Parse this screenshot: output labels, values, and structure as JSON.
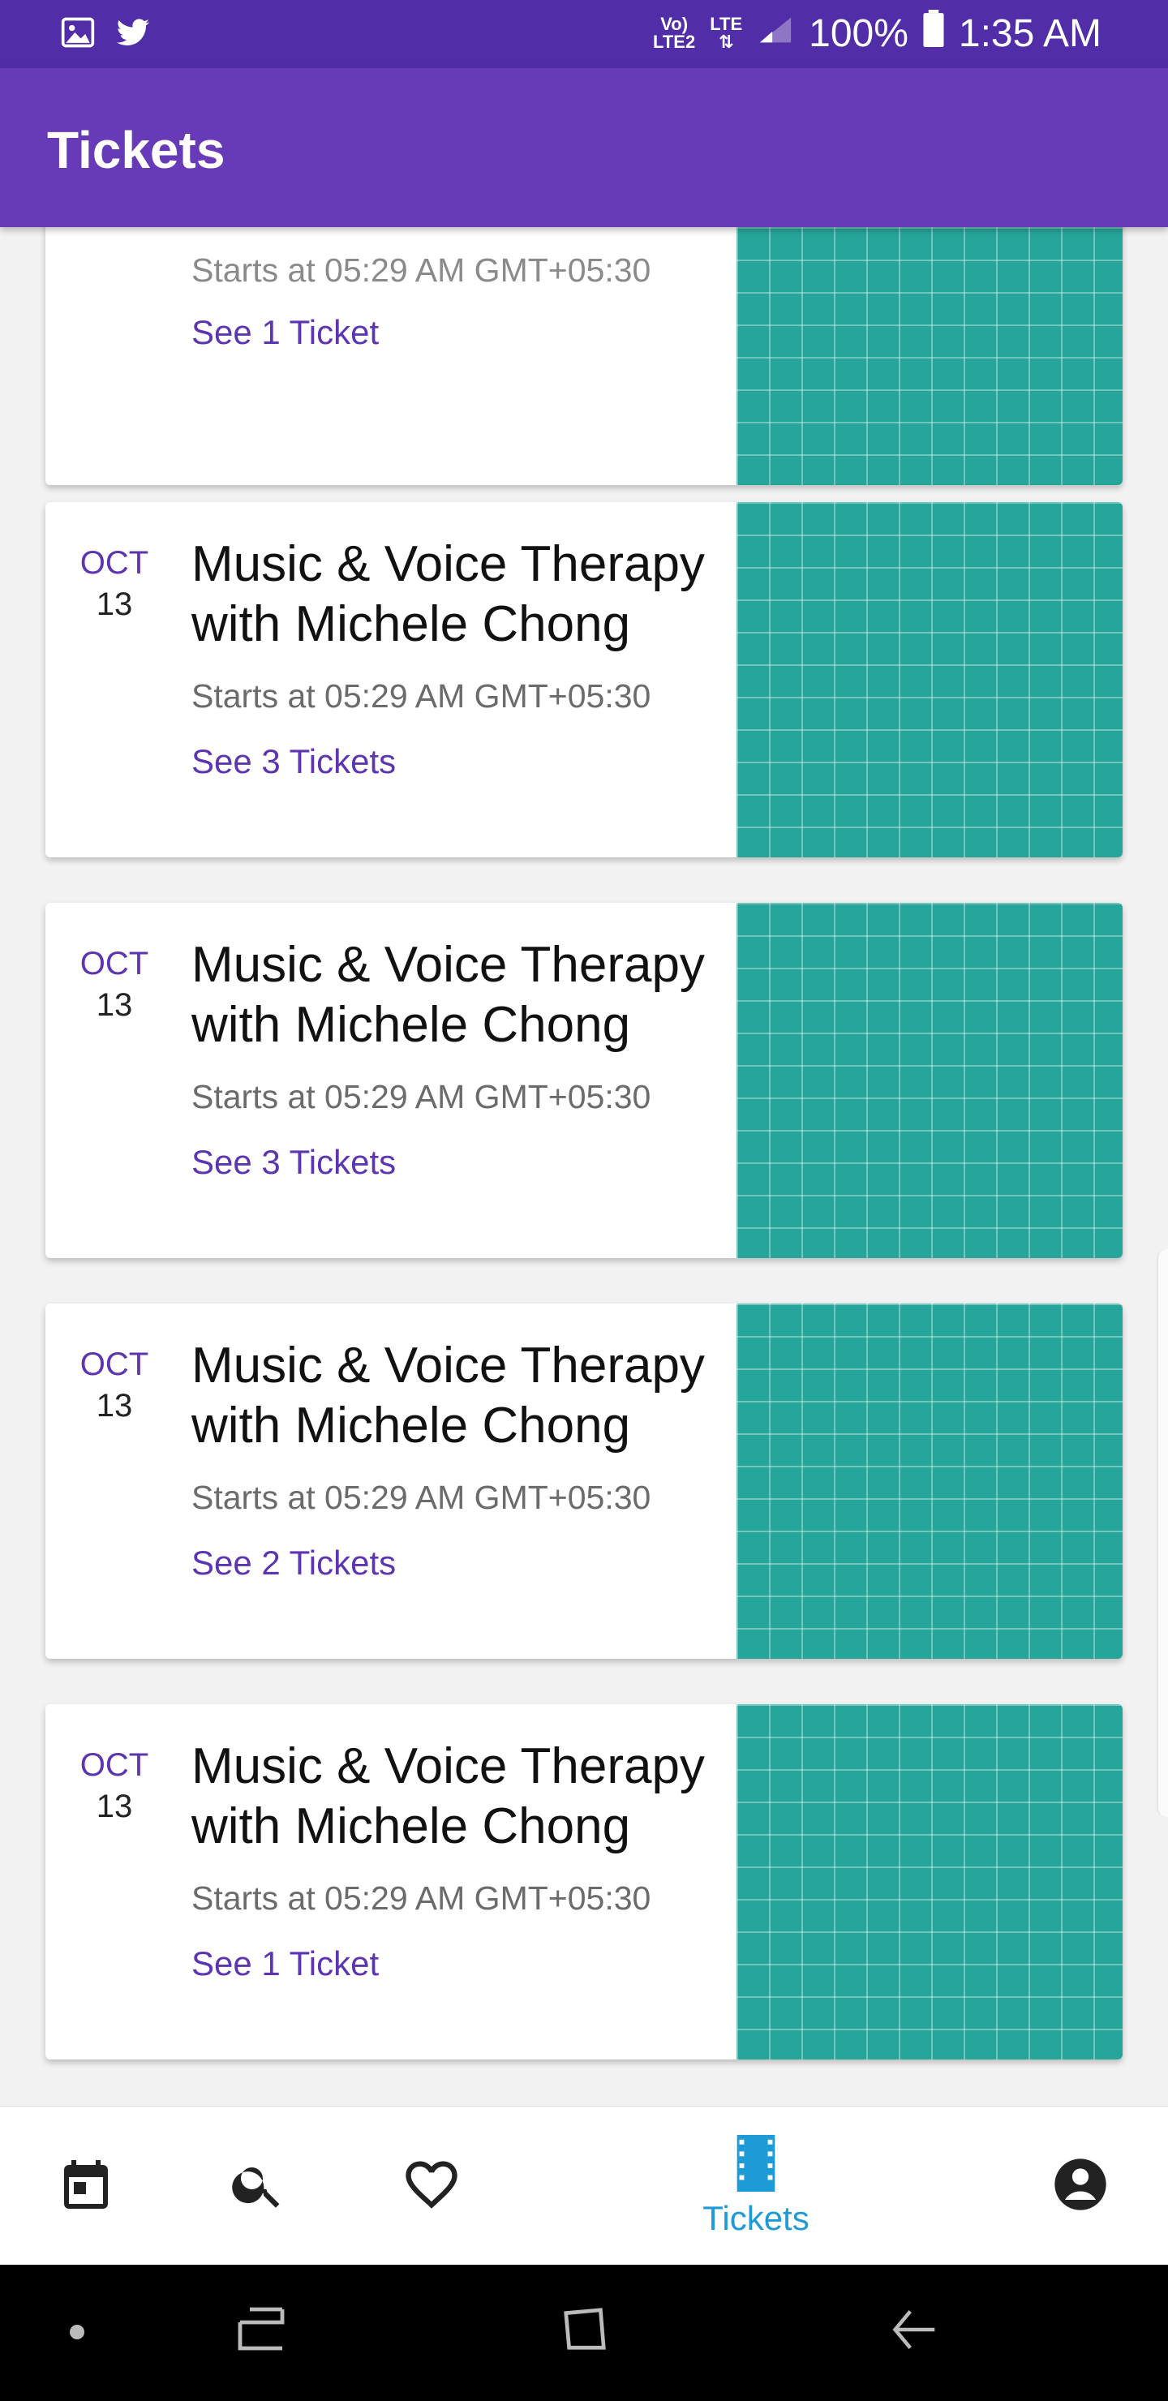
{
  "status_bar": {
    "network_label_top": "Vo)",
    "network_label_bottom": "LTE2",
    "lte_label": "LTE",
    "battery": "100%",
    "time": "1:35 AM"
  },
  "app_bar": {
    "title": "Tickets"
  },
  "tickets": [
    {
      "month": "",
      "day": "",
      "title": "",
      "time": "Starts at 05:29 AM GMT+05:30",
      "link": "See 1 Ticket"
    },
    {
      "month": "OCT",
      "day": "13",
      "title": "Music & Voice Therapy with Michele Chong",
      "time": "Starts at 05:29 AM GMT+05:30",
      "link": "See 3 Tickets"
    },
    {
      "month": "OCT",
      "day": "13",
      "title": "Music & Voice Therapy with Michele Chong",
      "time": "Starts at 05:29 AM GMT+05:30",
      "link": "See 3 Tickets"
    },
    {
      "month": "OCT",
      "day": "13",
      "title": "Music & Voice Therapy with Michele Chong",
      "time": "Starts at 05:29 AM GMT+05:30",
      "link": "See 2 Tickets"
    },
    {
      "month": "OCT",
      "day": "13",
      "title": "Music & Voice Therapy with Michele Chong",
      "time": "Starts at 05:29 AM GMT+05:30",
      "link": "See 1 Ticket"
    }
  ],
  "bottom_nav": {
    "items": [
      {
        "icon": "calendar-icon",
        "label": ""
      },
      {
        "icon": "search-icon",
        "label": ""
      },
      {
        "icon": "heart-icon",
        "label": ""
      },
      {
        "icon": "ticket-film-icon",
        "label": "Tickets",
        "active": true
      },
      {
        "icon": "account-icon",
        "label": ""
      }
    ],
    "active_color": "#1e9bd7",
    "inactive_color": "#222222"
  },
  "colors": {
    "status_bar": "#512da8",
    "app_bar": "#673ab7",
    "accent": "#5e35b1",
    "thumbnail": "#26a69a"
  }
}
